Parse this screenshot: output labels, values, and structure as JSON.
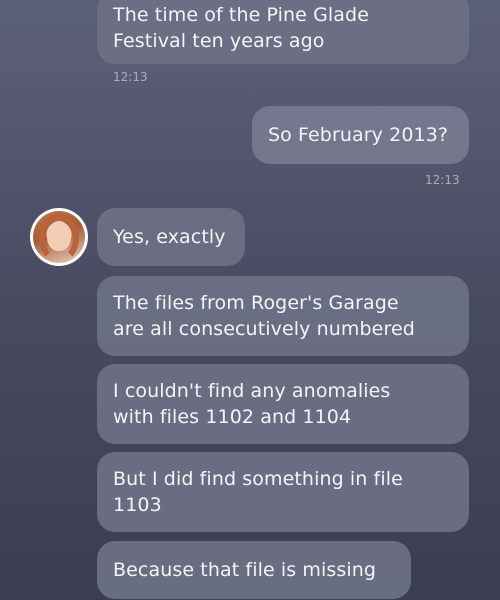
{
  "conversation": {
    "messages": [
      {
        "text": "The time of the Pine Glade\nFestival ten years ago",
        "direction": "incoming"
      },
      {
        "text": "So February 2013?",
        "direction": "outgoing"
      },
      {
        "text": "Yes, exactly",
        "direction": "incoming"
      },
      {
        "text": "The files from Roger's Garage\nare all consecutively numbered",
        "direction": "incoming"
      },
      {
        "text": "I couldn't find any anomalies\nwith files 1102 and 1104",
        "direction": "incoming"
      },
      {
        "text": "But I did find something in file\n1103",
        "direction": "incoming"
      },
      {
        "text": "Because that file is missing",
        "direction": "incoming"
      }
    ],
    "timestamps": [
      "12:13",
      "12:13"
    ]
  },
  "contact": {
    "avatar_icon": "contact-avatar"
  },
  "colors": {
    "background": "#4a4d63",
    "bubble": "#6e7186",
    "text": "#ffffff"
  }
}
